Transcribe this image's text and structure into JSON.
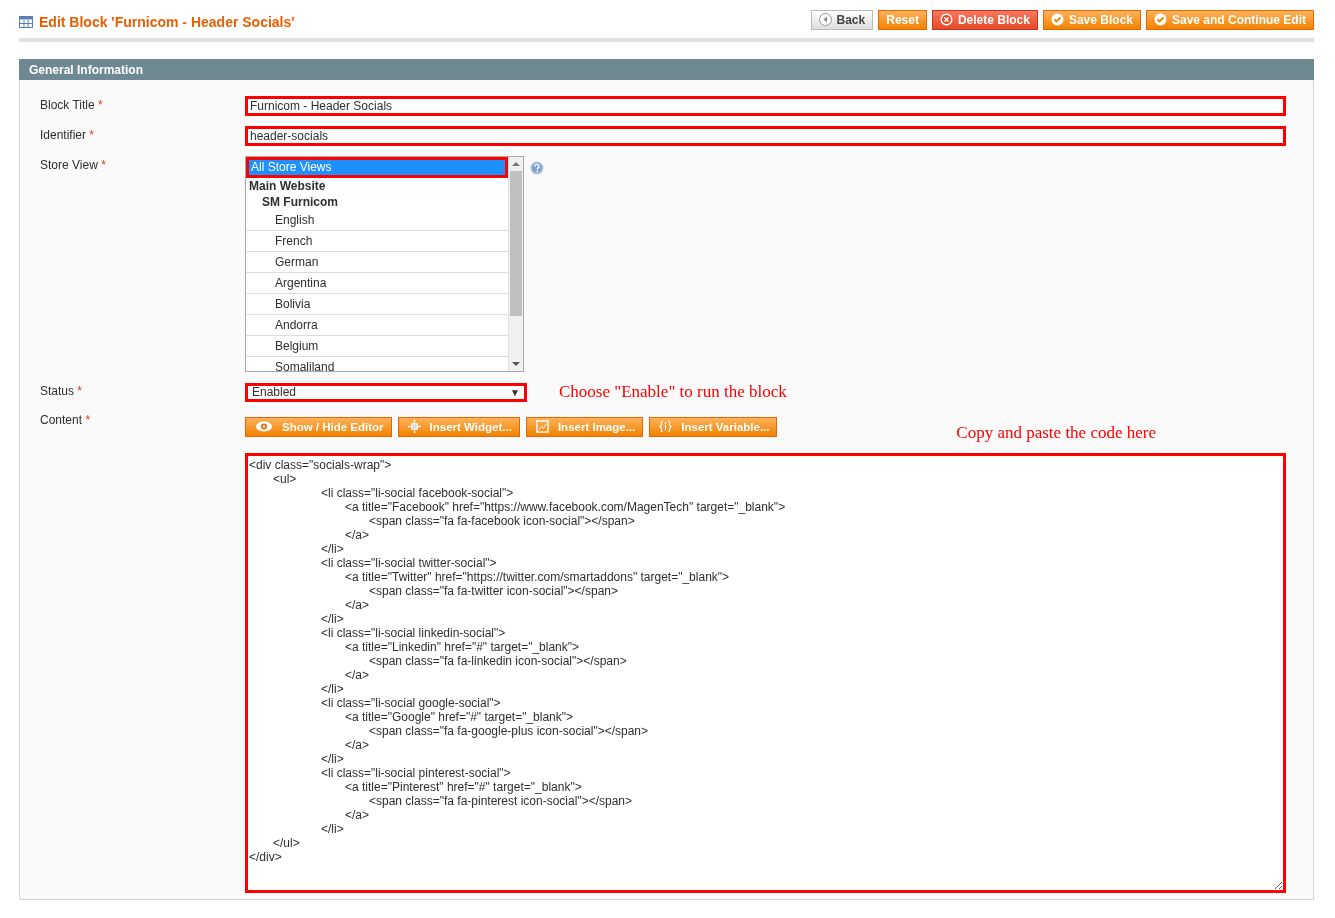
{
  "header": {
    "title": "Edit Block 'Furnicom - Header Socials'"
  },
  "actions": [
    {
      "label": "Back",
      "kind": "back"
    },
    {
      "label": "Reset",
      "kind": "plain"
    },
    {
      "label": "Delete Block",
      "kind": "delete"
    },
    {
      "label": "Save Block",
      "kind": "save"
    },
    {
      "label": "Save and Continue Edit",
      "kind": "save"
    }
  ],
  "section": {
    "title": "General Information"
  },
  "fields": [
    {
      "label": "Block Title",
      "required_mark": "*",
      "value": "Furnicom - Header Socials"
    },
    {
      "label": "Identifier",
      "required_mark": "*",
      "value": "header-socials"
    }
  ],
  "store_view": {
    "label": "Store View",
    "required_mark": "*",
    "options": [
      {
        "label": "All Store Views",
        "kind": "option",
        "selected": true
      },
      {
        "label": "Main Website",
        "kind": "group",
        "children": [
          {
            "label": "SM Furnicom",
            "kind": "group",
            "children": [
              {
                "label": "English",
                "kind": "option",
                "selected": false
              },
              {
                "label": "French",
                "kind": "option",
                "selected": false
              },
              {
                "label": "German",
                "kind": "option",
                "selected": false
              },
              {
                "label": "Argentina",
                "kind": "option",
                "selected": false
              },
              {
                "label": "Bolivia",
                "kind": "option",
                "selected": false
              },
              {
                "label": "Andorra",
                "kind": "option",
                "selected": false
              },
              {
                "label": "Belgium",
                "kind": "option",
                "selected": false
              },
              {
                "label": "Somaliland",
                "kind": "option",
                "selected": false
              }
            ]
          }
        ]
      }
    ]
  },
  "status": {
    "label": "Status",
    "required_mark": "*",
    "value": "Enabled",
    "caret": "▼",
    "note": "Choose \"Enable\" to run the block"
  },
  "content": {
    "label": "Content",
    "required_mark": "*",
    "note": "Copy and paste the code here",
    "buttons": [
      {
        "label": "Show / Hide Editor",
        "kind": "eye"
      },
      {
        "label": "Insert Widget...",
        "kind": "widget"
      },
      {
        "label": "Insert Image...",
        "kind": "image"
      },
      {
        "label": "Insert Variable...",
        "kind": "variable"
      }
    ],
    "code": "<div class=\"socials-wrap\">\n\t<ul>\n\t\t\t<li class=\"li-social facebook-social\">\n\t\t\t\t<a title=\"Facebook\" href=\"https://www.facebook.com/MagenTech\" target=\"_blank\">\n\t\t\t\t\t<span class=\"fa fa-facebook icon-social\"></span>\n\t\t\t\t</a>\n\t\t\t</li>\n\t\t\t<li class=\"li-social twitter-social\">\n\t\t\t\t<a title=\"Twitter\" href=\"https://twitter.com/smartaddons\" target=\"_blank\">\n\t\t\t\t\t<span class=\"fa fa-twitter icon-social\"></span>\n\t\t\t\t</a>\n\t\t\t</li>\n\t\t\t<li class=\"li-social linkedin-social\">\n\t\t\t\t<a title=\"Linkedin\" href=\"#\" target=\"_blank\">\n\t\t\t\t\t<span class=\"fa fa-linkedin icon-social\"></span>\n\t\t\t\t</a>\n\t\t\t</li>\n\t\t\t<li class=\"li-social google-social\">\n\t\t\t\t<a title=\"Google\" href=\"#\" target=\"_blank\">\n\t\t\t\t\t<span class=\"fa fa-google-plus icon-social\"></span>\n\t\t\t\t</a>\n\t\t\t</li>\n\t\t\t<li class=\"li-social pinterest-social\">\n\t\t\t\t<a title=\"Pinterest\" href=\"#\" target=\"_blank\">\n\t\t\t\t\t<span class=\"fa fa-pinterest icon-social\"></span>\n\t\t\t\t</a>\n\t\t\t</li>\n\t</ul>\n</div>"
  }
}
